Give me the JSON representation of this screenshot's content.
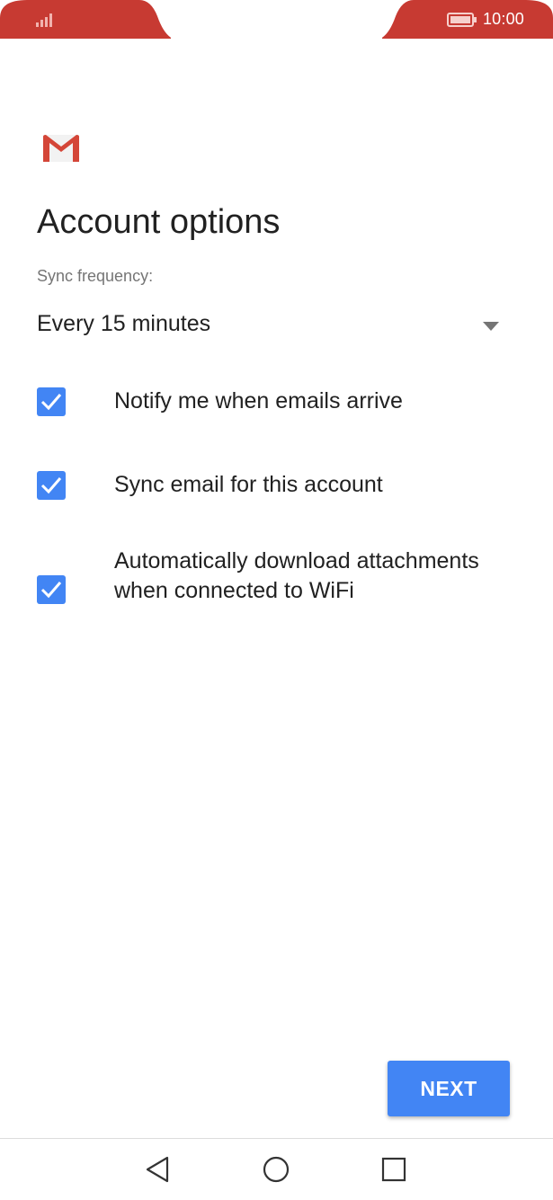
{
  "status_bar": {
    "time": "10:00",
    "accent_color": "#c73a32"
  },
  "app": {
    "logo_icon": "gmail-icon"
  },
  "page": {
    "title": "Account options"
  },
  "sync": {
    "label": "Sync frequency:",
    "selected_value": "Every 15 minutes"
  },
  "options": [
    {
      "label": "Notify me when emails arrive",
      "checked": true
    },
    {
      "label": "Sync email for this account",
      "checked": true
    },
    {
      "label": "Automatically download attachments when connected to WiFi",
      "checked": true
    }
  ],
  "actions": {
    "next_label": "NEXT",
    "primary_color": "#4285f4"
  },
  "nav_bar": {
    "back_icon": "back-triangle-icon",
    "home_icon": "home-circle-icon",
    "recents_icon": "recents-square-icon"
  }
}
